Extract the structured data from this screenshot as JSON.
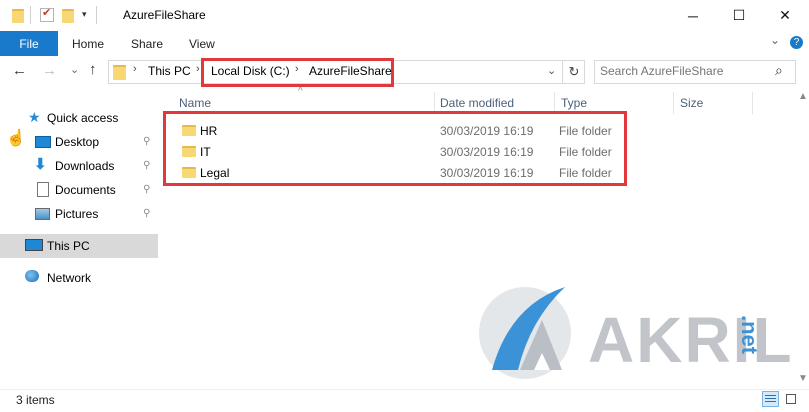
{
  "window": {
    "title": "AzureFileShare",
    "minimize_glyph": "─",
    "maximize_glyph": "☐",
    "close_glyph": "✕"
  },
  "ribbon": {
    "tabs": [
      "File",
      "Home",
      "Share",
      "View"
    ],
    "collapse_glyph": "⌄",
    "help_glyph": "?"
  },
  "nav": {
    "back_glyph": "←",
    "forward_glyph": "→",
    "recent_glyph": "⌄",
    "up_glyph": "↑",
    "breadcrumb": [
      "This PC",
      "Local Disk (C:)",
      "AzureFileShare"
    ],
    "sep_glyph": "›",
    "dropdown_glyph": "⌄",
    "refresh_glyph": "↻"
  },
  "search": {
    "placeholder": "Search AzureFileShare",
    "icon_glyph": "⌕"
  },
  "sidebar": {
    "quick_access": "Quick access",
    "items": [
      {
        "label": "Desktop"
      },
      {
        "label": "Downloads"
      },
      {
        "label": "Documents"
      },
      {
        "label": "Pictures"
      }
    ],
    "this_pc": "This PC",
    "network": "Network",
    "pin_glyph": "📌"
  },
  "columns": {
    "name": "Name",
    "date": "Date modified",
    "type": "Type",
    "size": "Size",
    "sort_glyph": "^"
  },
  "files": [
    {
      "name": "HR",
      "date": "30/03/2019 16:19",
      "type": "File folder"
    },
    {
      "name": "IT",
      "date": "30/03/2019 16:19",
      "type": "File folder"
    },
    {
      "name": "Legal",
      "date": "30/03/2019 16:19",
      "type": "File folder"
    }
  ],
  "status": {
    "count": "3 items"
  },
  "watermark": {
    "brand": "AKRIL",
    "tld": ".net"
  },
  "colors": {
    "accent": "#1979ca",
    "highlight": "#e0383d",
    "folder": "#f8d775"
  }
}
